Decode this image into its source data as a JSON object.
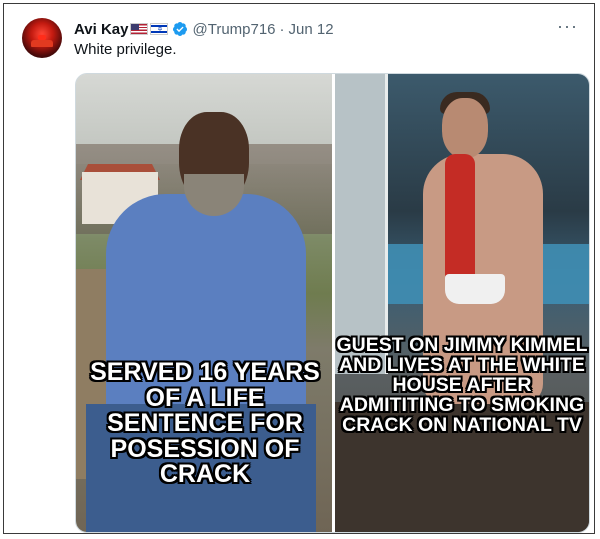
{
  "tweet": {
    "author_name": "Avi Kay",
    "flags": [
      "us-flag-icon",
      "israel-flag-icon"
    ],
    "verified": true,
    "handle": "@Trump716",
    "separator": "·",
    "date": "Jun 12",
    "more_label": "···",
    "text": "White privilege."
  },
  "media": {
    "left_caption": "SERVED 16 YEARS OF A LIFE SENTENCE FOR POSESSION OF CRACK",
    "right_caption": "GUEST ON JIMMY KIMMEL AND LIVES AT THE WHITE HOUSE AFTER ADMITITING TO SMOKING CRACK ON NATIONAL TV"
  },
  "colors": {
    "text_primary": "#0f1419",
    "text_secondary": "#536471",
    "verified_blue": "#1d9bf0"
  }
}
